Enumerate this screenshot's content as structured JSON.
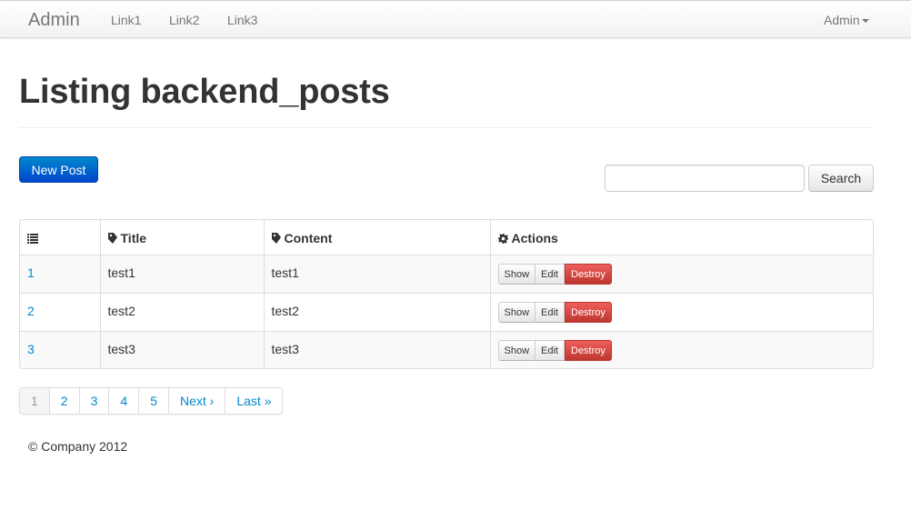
{
  "navbar": {
    "brand": "Admin",
    "links": [
      "Link1",
      "Link2",
      "Link3"
    ],
    "user_menu": "Admin"
  },
  "page": {
    "title": "Listing backend_posts"
  },
  "toolbar": {
    "new_post_label": "New Post",
    "search_value": "",
    "search_label": "Search"
  },
  "table": {
    "headers": {
      "id_icon": "list-icon",
      "title": "Title",
      "title_icon": "tag-icon",
      "content": "Content",
      "content_icon": "tag-icon",
      "actions": "Actions",
      "actions_icon": "cog-icon"
    },
    "rows": [
      {
        "id": "1",
        "title": "test1",
        "content": "test1"
      },
      {
        "id": "2",
        "title": "test2",
        "content": "test2"
      },
      {
        "id": "3",
        "title": "test3",
        "content": "test3"
      }
    ],
    "actions": {
      "show": "Show",
      "edit": "Edit",
      "destroy": "Destroy"
    }
  },
  "pagination": {
    "items": [
      "1",
      "2",
      "3",
      "4",
      "5",
      "Next ›",
      "Last »"
    ],
    "current": "1"
  },
  "footer": {
    "text": "© Company 2012"
  },
  "colors": {
    "primary": "#0088cc",
    "danger": "#bd362f",
    "link": "#0088cc"
  }
}
